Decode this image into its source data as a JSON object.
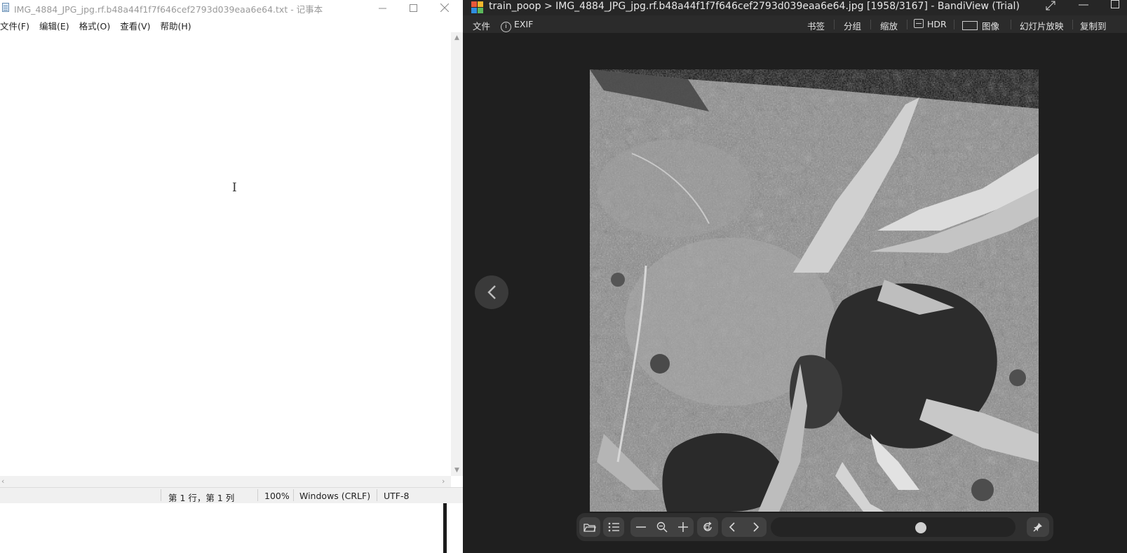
{
  "notepad": {
    "title": "IMG_4884_JPG_jpg.rf.b48a44f1f7f646cef2793d039eaa6e64.txt - 记事本",
    "menu": [
      "文件(F)",
      "编辑(E)",
      "格式(O)",
      "查看(V)",
      "帮助(H)"
    ],
    "content": "",
    "status": {
      "position": "第 1 行，第 1 列",
      "zoom": "100%",
      "line_ending": "Windows (CRLF)",
      "encoding": "UTF-8"
    }
  },
  "viewer": {
    "title": "train_poop > IMG_4884_JPG_jpg.rf.b48a44f1f7f646cef2793d039eaa6e64.jpg [1958/3167] - BandiView (Trial)",
    "toolbar": {
      "file": "文件",
      "exif": "EXIF",
      "bookmark": "书签",
      "group": "分组",
      "zoom": "缩放",
      "hdr": "HDR",
      "image": "图像",
      "slideshow": "幻灯片放映",
      "copy_to": "复制到"
    },
    "image_index": 1958,
    "image_total": 3167,
    "slider_progress": 0.62,
    "colors": {
      "background": "#1f1f1f",
      "toolbar": "#2b2b2b",
      "bottom_bar": "#2f2f2f"
    },
    "bottom_icons": [
      "open-folder-icon",
      "list-icon",
      "zoom-out-icon",
      "zoom-fit-icon",
      "zoom-in-icon",
      "rotate-icon",
      "previous-icon",
      "next-icon",
      "pin-icon"
    ]
  }
}
